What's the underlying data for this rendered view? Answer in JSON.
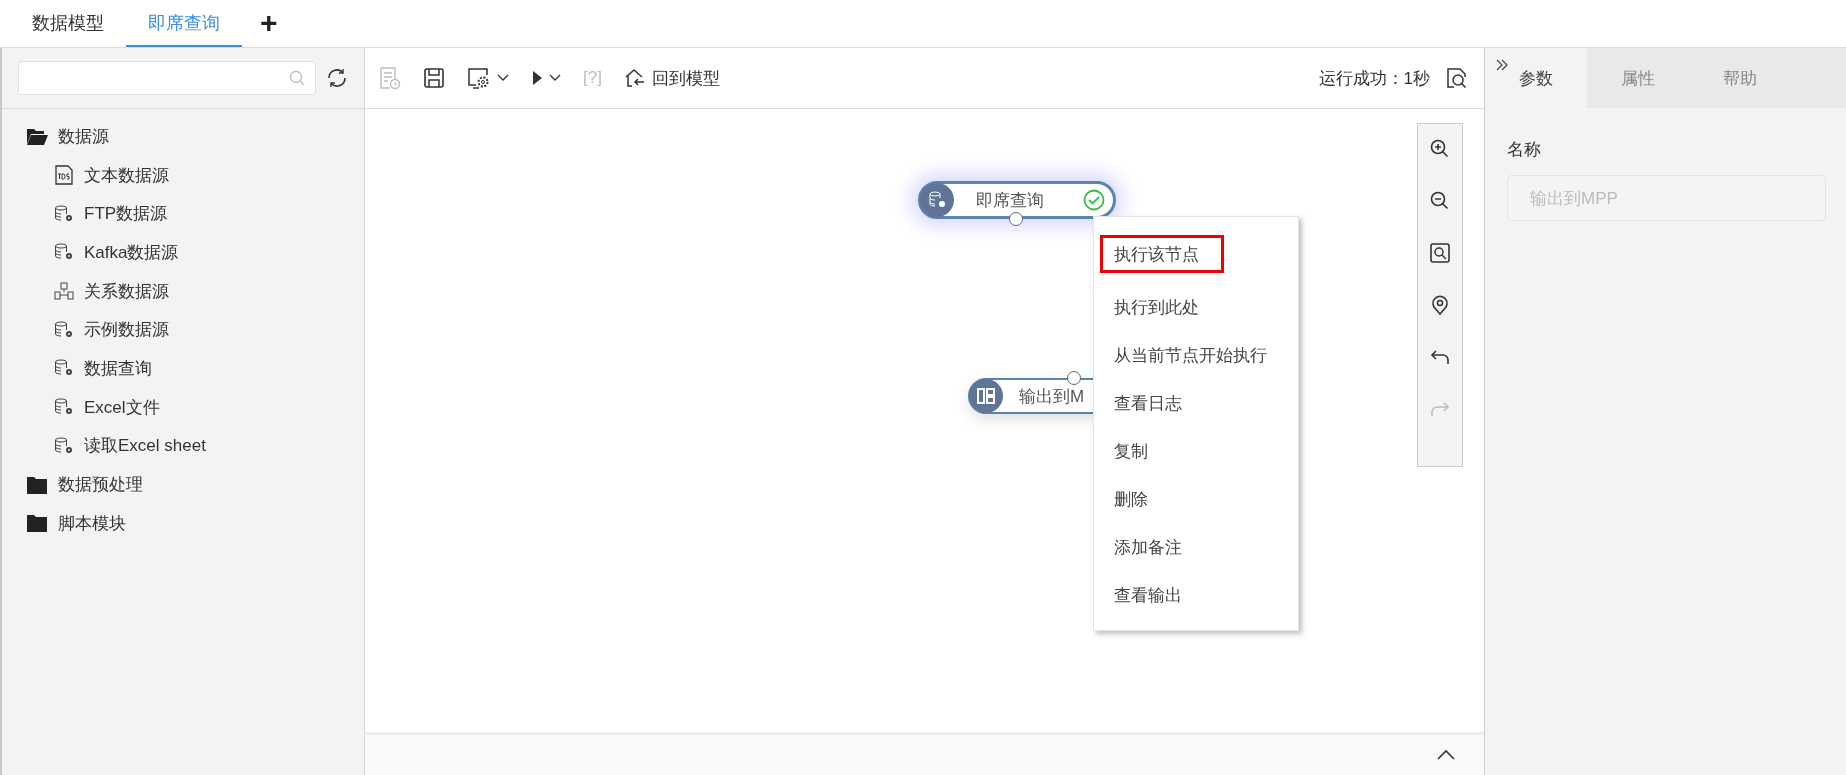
{
  "top_tabs": [
    {
      "label": "数据模型",
      "selected": false
    },
    {
      "label": "即席查询",
      "selected": true
    },
    {
      "label": "+",
      "kind": "add"
    }
  ],
  "sidebar": {
    "tree": [
      {
        "label": "数据源",
        "expanded": true,
        "children": [
          {
            "label": "文本数据源",
            "kind": "text-file"
          },
          {
            "label": "FTP数据源",
            "kind": "database"
          },
          {
            "label": "Kafka数据源",
            "kind": "database"
          },
          {
            "label": "关系数据源",
            "kind": "relational"
          },
          {
            "label": "示例数据源",
            "kind": "database"
          },
          {
            "label": "数据查询",
            "kind": "database"
          },
          {
            "label": "Excel文件",
            "kind": "database"
          },
          {
            "label": "读取Excel sheet",
            "kind": "database"
          }
        ]
      },
      {
        "label": "数据预处理",
        "expanded": false
      },
      {
        "label": "脚本模块",
        "expanded": false
      }
    ]
  },
  "toolbar": {
    "buttons": [
      {
        "kind": "schedule",
        "disabled": true
      },
      {
        "kind": "save",
        "disabled": false
      },
      {
        "kind": "settings",
        "disabled": false,
        "dropdown": true
      },
      {
        "kind": "run",
        "disabled": false,
        "dropdown": true
      },
      {
        "kind": "help",
        "label": "[?]",
        "disabled": true
      },
      {
        "kind": "back",
        "label": "回到模型",
        "disabled": false
      }
    ],
    "status": "运行成功：1秒"
  },
  "canvas": {
    "nodes": [
      {
        "label": "即席查询",
        "kind": "database",
        "selected": true,
        "success": true
      },
      {
        "label": "输出到M",
        "kind": "output",
        "selected": false
      }
    ],
    "context_menu": [
      {
        "label": "执行该节点",
        "highlighted": true
      },
      {
        "label": "执行到此处",
        "highlighted": false
      },
      {
        "label": "从当前节点开始执行",
        "highlighted": false
      },
      {
        "label": "查看日志",
        "highlighted": false
      },
      {
        "label": "复制",
        "highlighted": false
      },
      {
        "label": "删除",
        "highlighted": false
      },
      {
        "label": "添加备注",
        "highlighted": false
      },
      {
        "label": "查看输出",
        "highlighted": false
      }
    ],
    "zoom_tools": [
      {
        "kind": "zoom-in",
        "disabled": false
      },
      {
        "kind": "zoom-out",
        "disabled": false
      },
      {
        "kind": "fit",
        "disabled": false
      },
      {
        "kind": "locate",
        "disabled": false
      },
      {
        "kind": "undo",
        "disabled": false
      },
      {
        "kind": "redo",
        "disabled": true
      }
    ]
  },
  "right_panel": {
    "tabs": [
      {
        "label": "参数",
        "selected": true
      },
      {
        "label": "属性",
        "selected": false
      },
      {
        "label": "帮助",
        "selected": false
      }
    ],
    "fields": [
      {
        "label": "名称",
        "value": "输出到MPP",
        "disabled": true
      }
    ]
  }
}
